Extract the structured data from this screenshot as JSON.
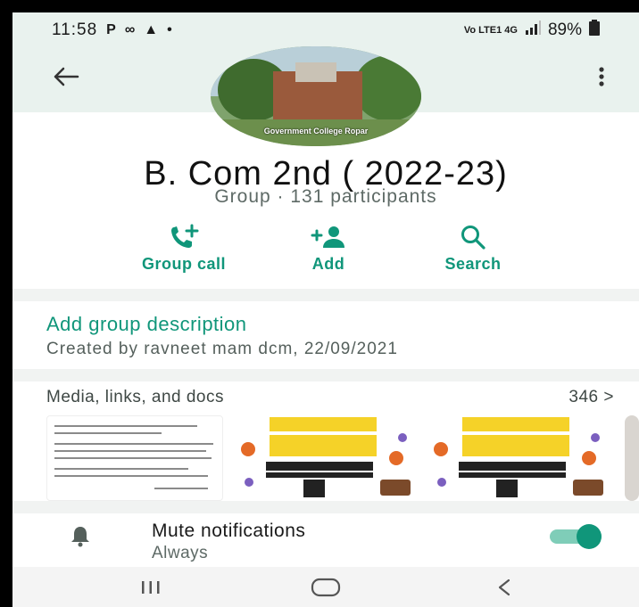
{
  "status_bar": {
    "time": "11:58",
    "left_icons": [
      "P",
      "∞",
      "▲",
      "•"
    ],
    "network": "Vo LTE1 4G",
    "battery": "89%"
  },
  "header": {
    "back_icon": "arrow-left-icon",
    "menu_icon": "more-vert-icon",
    "avatar_caption": "Government College Ropar"
  },
  "group": {
    "name": "B. Com 2nd  ( 2022-23)",
    "subtitle": "Group · 131 participants"
  },
  "actions": [
    {
      "label": "Group call",
      "icon": "add-call-icon"
    },
    {
      "label": "Add",
      "icon": "add-person-icon"
    },
    {
      "label": "Search",
      "icon": "search-icon"
    }
  ],
  "description": {
    "add_label": "Add group description",
    "created": "Created by ravneet mam dcm, 22/09/2021"
  },
  "media": {
    "header": "Media, links, and docs",
    "count": "346 >"
  },
  "mute": {
    "title": "Mute notifications",
    "subtitle": "Always",
    "enabled": true
  },
  "colors": {
    "accent": "#10967a",
    "header_bg": "#e9f2ee"
  }
}
